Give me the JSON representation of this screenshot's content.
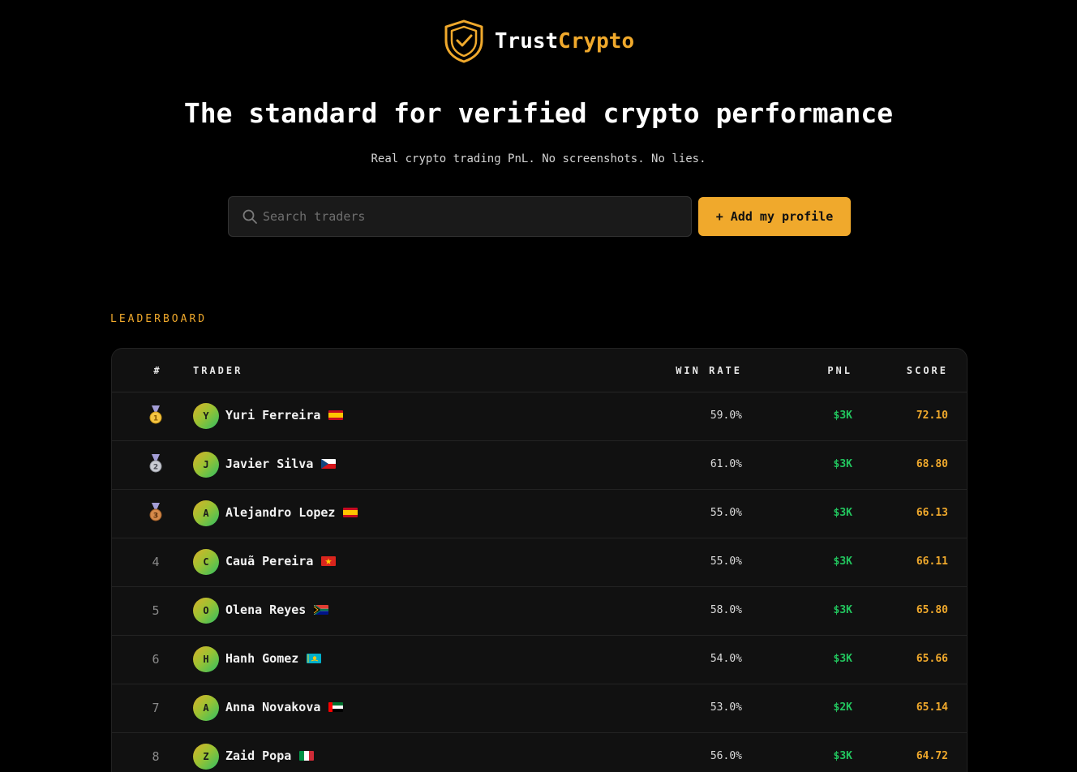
{
  "brand": {
    "name_part1": "Trust",
    "name_part2": "Crypto",
    "logo_icon": "shield-check-icon",
    "accent_color": "#f0a92c"
  },
  "hero": {
    "headline": "The standard for verified crypto performance",
    "subline": "Real crypto trading PnL. No screenshots. No lies."
  },
  "search": {
    "placeholder": "Search traders",
    "value": "",
    "icon": "search-icon"
  },
  "actions": {
    "add_profile_label": "+ Add my profile"
  },
  "leaderboard": {
    "section_label": "LEADERBOARD",
    "columns": {
      "rank": "#",
      "trader": "TRADER",
      "win_rate": "WIN RATE",
      "pnl": "PNL",
      "score": "SCORE"
    },
    "rows": [
      {
        "rank": "1",
        "medal": "gold-medal-icon",
        "initial": "Y",
        "name": "Yuri Ferreira",
        "flag": "spain-flag-icon",
        "win_rate": "59.0%",
        "pnl": "$3K",
        "score": "72.10"
      },
      {
        "rank": "2",
        "medal": "silver-medal-icon",
        "initial": "J",
        "name": "Javier Silva",
        "flag": "czech-flag-icon",
        "win_rate": "61.0%",
        "pnl": "$3K",
        "score": "68.80"
      },
      {
        "rank": "3",
        "medal": "bronze-medal-icon",
        "initial": "A",
        "name": "Alejandro Lopez",
        "flag": "spain-flag-icon",
        "win_rate": "55.0%",
        "pnl": "$3K",
        "score": "66.13"
      },
      {
        "rank": "4",
        "medal": "",
        "initial": "C",
        "name": "Cauã Pereira",
        "flag": "vietnam-flag-icon",
        "win_rate": "55.0%",
        "pnl": "$3K",
        "score": "66.11"
      },
      {
        "rank": "5",
        "medal": "",
        "initial": "O",
        "name": "Olena Reyes",
        "flag": "south-africa-flag-icon",
        "win_rate": "58.0%",
        "pnl": "$3K",
        "score": "65.80"
      },
      {
        "rank": "6",
        "medal": "",
        "initial": "H",
        "name": "Hanh Gomez",
        "flag": "kazakhstan-flag-icon",
        "win_rate": "54.0%",
        "pnl": "$3K",
        "score": "65.66"
      },
      {
        "rank": "7",
        "medal": "",
        "initial": "A",
        "name": "Anna Novakova",
        "flag": "uae-flag-icon",
        "win_rate": "53.0%",
        "pnl": "$2K",
        "score": "65.14"
      },
      {
        "rank": "8",
        "medal": "",
        "initial": "Z",
        "name": "Zaid Popa",
        "flag": "italy-flag-icon",
        "win_rate": "56.0%",
        "pnl": "$3K",
        "score": "64.72"
      }
    ]
  }
}
